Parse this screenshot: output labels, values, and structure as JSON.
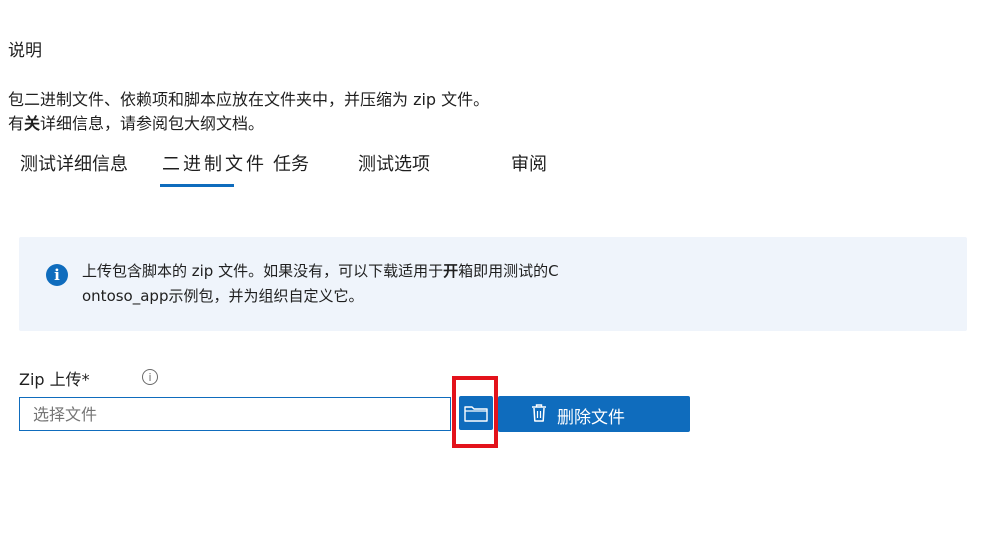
{
  "section_title": "说明",
  "description": {
    "line1": "包二进制文件、依赖项和脚本应放在文件夹中，并压缩为 zip 文件。",
    "line2_prefix": "有",
    "line2_bold": "关",
    "line2_suffix": "详细信息，请参阅包大纲文档。"
  },
  "tabs": [
    {
      "label": "测试详细信息"
    },
    {
      "label": "二进制文件"
    },
    {
      "label": "任务"
    },
    {
      "label": "测试选项"
    },
    {
      "label": "审阅"
    }
  ],
  "info_box": {
    "icon": "info-icon",
    "line1_prefix": "上传包含脚本的 zip 文件。如果没有，可以下载适用于",
    "line1_bold": "开",
    "line1_suffix": "箱即用测试的C",
    "line2": "ontoso_app示例包，并为组织自定义它。"
  },
  "zip_upload": {
    "label": "Zip 上传*",
    "help_icon": "info-outline-icon",
    "help_glyph": "i",
    "placeholder": "选择文件",
    "browse_icon": "folder-icon",
    "delete_icon": "trash-icon",
    "delete_label": "删除文件"
  },
  "colors": {
    "accent": "#0f6cbd",
    "info_bg": "#eff4fb",
    "highlight": "#e3121b"
  }
}
